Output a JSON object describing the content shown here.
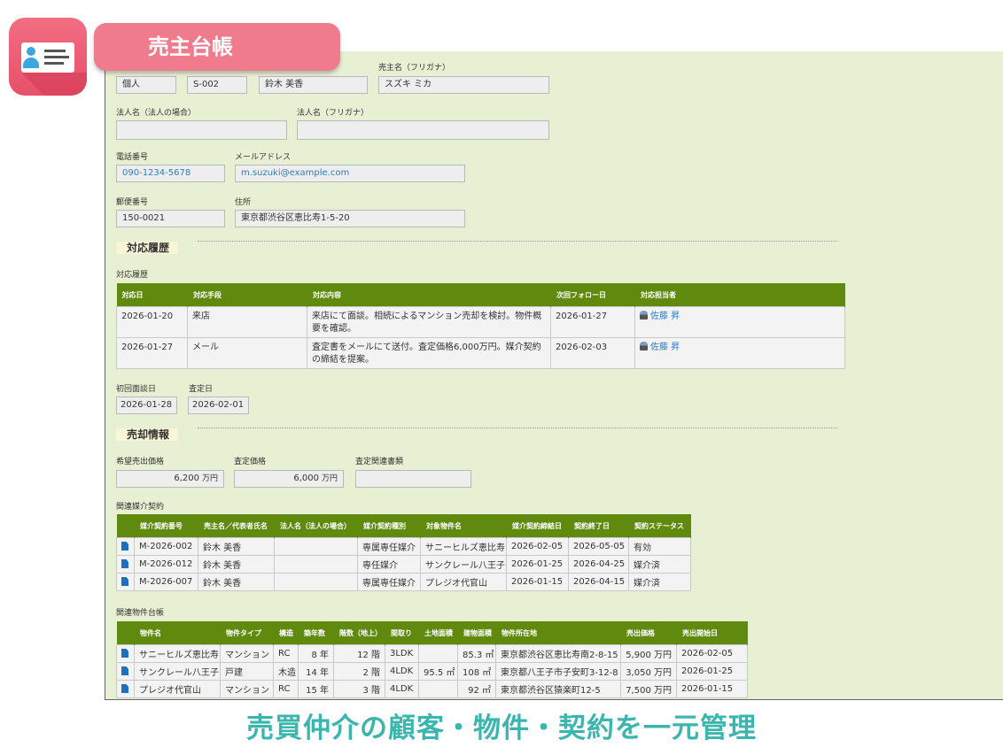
{
  "app": {
    "tab_title": "売主台帳",
    "icon": "contact-card-icon"
  },
  "seller": {
    "type": "個人",
    "id": "S-002",
    "name": "鈴木 美香",
    "kana_label": "売主名（フリガナ）",
    "kana": "スズキ ミカ",
    "corp_label": "法人名（法人の場合）",
    "corp": "",
    "corp_kana_label": "法人名（フリガナ）",
    "corp_kana": "",
    "phone_label": "電話番号",
    "phone": "090-1234-5678",
    "email_label": "メールアドレス",
    "email": "m.suzuki@example.com",
    "zip_label": "郵便番号",
    "zip": "150-0021",
    "address_label": "住所",
    "address": "東京都渋谷区恵比寿1-5-20"
  },
  "history": {
    "section_title": "対応履歴",
    "label": "対応履歴",
    "headers": [
      "対応日",
      "対応手段",
      "対応内容",
      "次回フォロー日",
      "対応担当者"
    ],
    "rows": [
      [
        "2026-01-20",
        "来店",
        "来店にて面談。相続によるマンション売却を検討。物件概要を確認。",
        "2026-01-27",
        "佐藤 昇"
      ],
      [
        "2026-01-27",
        "メール",
        "査定書をメールにて送付。査定価格6,000万円。媒介契約の締結を提案。",
        "2026-02-03",
        "佐藤 昇"
      ]
    ],
    "first_meeting_label": "初回面談日",
    "first_meeting": "2026-01-28",
    "appraisal_date_label": "査定日",
    "appraisal_date": "2026-02-01"
  },
  "sale": {
    "section_title": "売却情報",
    "desired_price_label": "希望売出価格",
    "desired_price": "6,200",
    "unit": "万円",
    "appraisal_price_label": "査定価格",
    "appraisal_price": "6,000",
    "appraisal_docs_label": "査定関連書類",
    "appraisal_docs": ""
  },
  "contracts": {
    "label": "関連媒介契約",
    "headers": [
      "媒介契約番号",
      "売主名／代表者氏名",
      "法人名（法人の場合）",
      "媒介契約種別",
      "対象物件名",
      "媒介契約締結日",
      "契約終了日",
      "契約ステータス"
    ],
    "rows": [
      [
        "M-2026-002",
        "鈴木 美香",
        "",
        "専属専任媒介",
        "サニーヒルズ恵比寿",
        "2026-02-05",
        "2026-05-05",
        "有効"
      ],
      [
        "M-2026-012",
        "鈴木 美香",
        "",
        "専任媒介",
        "サンクレール八王子",
        "2026-01-25",
        "2026-04-25",
        "媒介済"
      ],
      [
        "M-2026-007",
        "鈴木 美香",
        "",
        "専属専任媒介",
        "プレジオ代官山",
        "2026-01-15",
        "2026-04-15",
        "媒介済"
      ]
    ]
  },
  "properties": {
    "label": "関連物件台帳",
    "headers": [
      "物件名",
      "物件タイプ",
      "構造",
      "築年数",
      "階数（地上）",
      "間取り",
      "土地面積",
      "建物面積",
      "物件所在地",
      "売出価格",
      "売出開始日"
    ],
    "rows": [
      [
        "サニーヒルズ恵比寿",
        "マンション",
        "RC",
        "8 年",
        "12 階",
        "3LDK",
        "",
        "85.3 ㎡",
        "東京都渋谷区恵比寿南2-8-15",
        "5,900 万円",
        "2026-02-05"
      ],
      [
        "サンクレール八王子",
        "戸建",
        "木造",
        "14 年",
        "2 階",
        "4LDK",
        "95.5 ㎡",
        "108 ㎡",
        "東京都八王子市子安町3-12-8",
        "3,050 万円",
        "2026-01-25"
      ],
      [
        "プレジオ代官山",
        "マンション",
        "RC",
        "15 年",
        "3 階",
        "4LDK",
        "",
        "92 ㎡",
        "東京都渋谷区猿楽町12-5",
        "7,500 万円",
        "2026-01-15"
      ]
    ]
  },
  "caption": "売買仲介の顧客・物件・契約を一元管理",
  "colors": {
    "header_green": "#5f8a0e",
    "pane_bg": "#e8f0d3",
    "tab_pink": "#f07b8c",
    "caption_teal": "#3bb6ae"
  }
}
